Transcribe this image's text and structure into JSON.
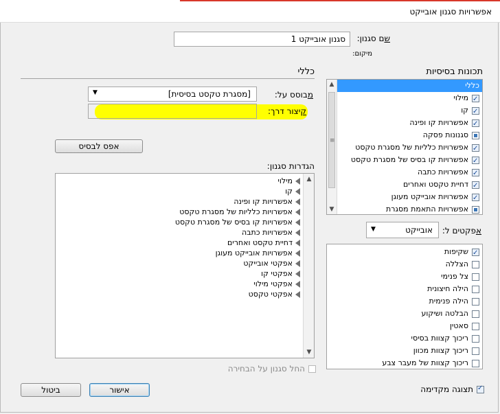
{
  "window": {
    "title": "אפשרויות סגנון אובייקט"
  },
  "style_name": {
    "label": "שם סגנון:",
    "value": "סגנון אובייקט 1",
    "location_label": "מיקום:"
  },
  "left_section_title": "כללי",
  "based_on": {
    "label": "מבוסס על:",
    "value": "[מסגרת טקסט בסיסית]"
  },
  "shortcut": {
    "label": "קיצור דרך:",
    "value": ""
  },
  "reset_button": "אפס לבסיס",
  "style_settings": {
    "label": "הגדרות סגנון:",
    "items": [
      "מילוי",
      "קו",
      "אפשרויות קו ופינה",
      "אפשרויות כלליות של מסגרת טקסט",
      "אפשרויות קו בסיס של מסגרת טקסט",
      "אפשרויות כתבה",
      "דחיית טקסט ואחרים",
      "אפשרויות אובייקט מעוגן",
      "אפקטי אובייקט",
      "אפקטי קו",
      "אפקטי מילוי",
      "אפקטי טקסט"
    ]
  },
  "apply_on_selection": "החל סגנון על הבחירה",
  "basic_attributes": {
    "label": "תכונות בסיסיות",
    "items": [
      {
        "label": "כללי",
        "state": "none",
        "selected": true
      },
      {
        "label": "מילוי",
        "state": "checked"
      },
      {
        "label": "קו",
        "state": "checked"
      },
      {
        "label": "אפשרויות קו ופינה",
        "state": "checked"
      },
      {
        "label": "סגנונות פסקה",
        "state": "filled"
      },
      {
        "label": "אפשרויות כלליות של מסגרת טקסט",
        "state": "checked"
      },
      {
        "label": "אפשרויות קו בסיס של מסגרת טקסט",
        "state": "checked"
      },
      {
        "label": "אפשרויות כתבה",
        "state": "checked"
      },
      {
        "label": "דחיית טקסט ואחרים",
        "state": "checked"
      },
      {
        "label": "אפשרויות אובייקט מעוגן",
        "state": "checked"
      },
      {
        "label": "אפשרויות התאמת מסגרת",
        "state": "filled"
      }
    ]
  },
  "effects_for": {
    "label": "אפקטים ל:",
    "value": "אובייקט"
  },
  "effects": {
    "items": [
      {
        "label": "שקיפות",
        "checked": true
      },
      {
        "label": "הצללה",
        "checked": false
      },
      {
        "label": "צל פנימי",
        "checked": false
      },
      {
        "label": "הילה חיצונית",
        "checked": false
      },
      {
        "label": "הילה פנימית",
        "checked": false
      },
      {
        "label": "הבלטה ושיקוע",
        "checked": false
      },
      {
        "label": "סאטין",
        "checked": false
      },
      {
        "label": "ריכוך קצוות בסיסי",
        "checked": false
      },
      {
        "label": "ריכוך קצוות מכוון",
        "checked": false
      },
      {
        "label": "ריכוך קצוות של מעבר צבע",
        "checked": false
      }
    ]
  },
  "preview": {
    "label": "תצוגה מקדימה",
    "checked": true
  },
  "buttons": {
    "ok": "אישור",
    "cancel": "ביטול"
  },
  "colors": {
    "highlight": "#ffff00",
    "selection": "#3399ff",
    "title_accent": "#d8372a"
  }
}
